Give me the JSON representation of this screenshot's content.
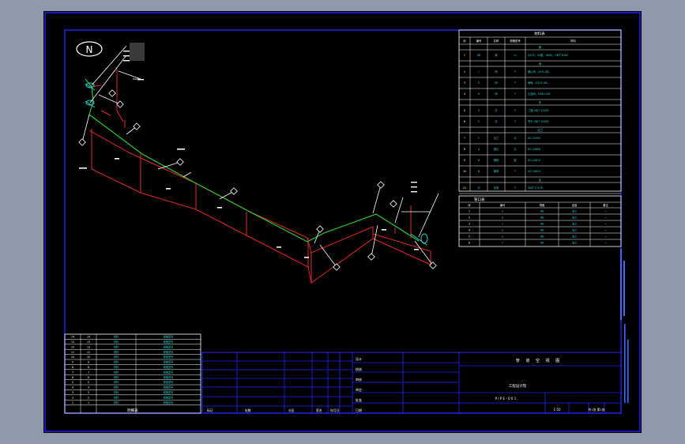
{
  "compass": {
    "letter": "N"
  },
  "colors": {
    "frame": "#2323ff",
    "pipe": "#2bd42b",
    "section": "#e02828",
    "text": "#ffffff",
    "cyan": "#27d3d3",
    "viewport_bg": "#000000",
    "app_bg": "#8f99ab"
  },
  "callout_numbers": [
    "1",
    "2",
    "3",
    "4",
    "5",
    "6",
    "7",
    "8",
    "9",
    "10",
    "11",
    "12",
    "13",
    "14",
    "15",
    "16",
    "17",
    "18",
    "19",
    "20"
  ],
  "tags": {
    "pipe_note": "pipe"
  },
  "right_table": {
    "title": "材料表",
    "headers": [
      "序",
      "编号",
      "名称",
      "规格型号",
      "材料"
    ],
    "sections": [
      {
        "label": "管",
        "rows": [
          [
            "1",
            "DN",
            "管",
            "m",
            "Q235，20钢，16Mn，GB/T 8163"
          ]
        ]
      },
      {
        "label": "阀",
        "rows": [
          [
            "2",
            "J",
            "阀",
            "个",
            "截止阀，J41H-16C"
          ],
          [
            "3",
            "Z",
            "阀",
            "个",
            "闸阀，Z41H-16C"
          ],
          [
            "4",
            "H",
            "阀",
            "个",
            "止回阀，H44H-16C"
          ]
        ]
      },
      {
        "label": "件",
        "rows": [
          [
            "5",
            "S",
            "件",
            "个",
            "三通 GB/T 12459"
          ],
          [
            "6",
            "E",
            "件",
            "个",
            "弯头 GB/T 12459"
          ]
        ]
      },
      {
        "label": "法兰",
        "rows": [
          [
            "7",
            "F",
            "法兰",
            "片",
            "HG 20592"
          ],
          [
            "8",
            "G",
            "垫片",
            "片",
            "HG 20606"
          ],
          [
            "9",
            "B",
            "螺栓",
            "套",
            "HG 20613"
          ],
          [
            "10",
            "N",
            "螺母",
            "个",
            "HG 20613"
          ]
        ]
      },
      {
        "label": "支",
        "rows": [
          [
            "11",
            "ZJ",
            "支架",
            "个",
            "GB/T 17116"
          ]
        ]
      }
    ]
  },
  "nozzle_table": {
    "title": "管口表",
    "headers": [
      "序",
      "编号",
      "规格",
      "连接",
      "备注"
    ],
    "rows": [
      [
        "1",
        "a",
        "DN",
        "法兰",
        "—"
      ],
      [
        "2",
        "b",
        "DN",
        "法兰",
        "—"
      ],
      [
        "3",
        "c",
        "DN",
        "法兰",
        "—"
      ],
      [
        "4",
        "d",
        "DN",
        "法兰",
        "—"
      ],
      [
        "5",
        "e",
        "DN",
        "法兰",
        "—"
      ],
      [
        "6",
        "f",
        "DN",
        "法兰",
        "—"
      ]
    ]
  },
  "left_table": {
    "title": "明细表",
    "rows": [
      [
        "14",
        "14",
        "材料",
        "规格型号"
      ],
      [
        "13",
        "13",
        "材料",
        "规格型号"
      ],
      [
        "12",
        "12",
        "材料",
        "规格型号"
      ],
      [
        "11",
        "11",
        "材料",
        "规格型号"
      ],
      [
        "10",
        "10",
        "材料",
        "规格型号"
      ],
      [
        "9",
        "9",
        "材料",
        "规格型号"
      ],
      [
        "8",
        "8",
        "材料",
        "规格型号"
      ],
      [
        "7",
        "7",
        "材料",
        "规格型号"
      ],
      [
        "6",
        "6",
        "材料",
        "规格型号"
      ],
      [
        "5",
        "5",
        "材料",
        "规格型号"
      ],
      [
        "4",
        "4",
        "材料",
        "规格型号"
      ],
      [
        "3",
        "3",
        "材料",
        "规格型号"
      ],
      [
        "2",
        "2",
        "材料",
        "规格型号"
      ],
      [
        "1",
        "1",
        "材料",
        "规格型号"
      ]
    ]
  },
  "title_block": {
    "drawing_title": "管 道 空 视 图",
    "labels": [
      "设计",
      "校核",
      "审核",
      "审定",
      "批准",
      "日期"
    ],
    "company": "工程设计院",
    "drawing_no": "P I P E - 0 0 1",
    "scale": "1:50",
    "sheet": "共1张 第1张",
    "bottom_labels": [
      "标记",
      "处数",
      "分区",
      "签名",
      "年月日"
    ]
  }
}
